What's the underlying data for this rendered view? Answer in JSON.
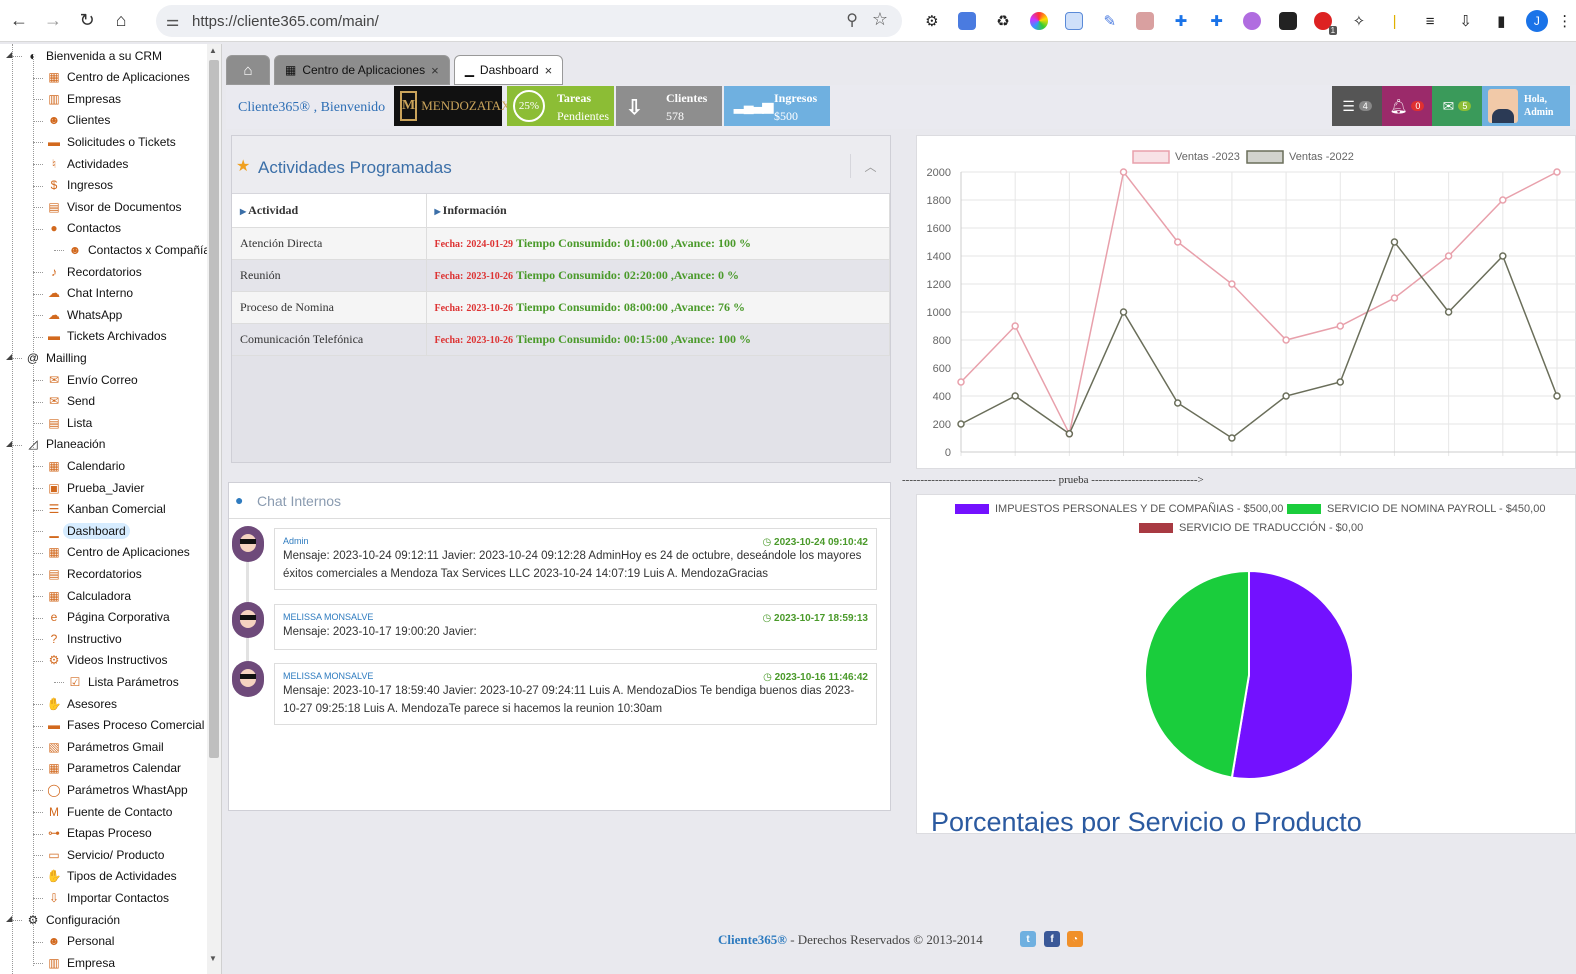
{
  "browser": {
    "url": "https://cliente365.com/main/",
    "profile_initial": "J",
    "ext_badge": "1"
  },
  "sidebar": {
    "items": [
      {
        "label": "Bienvenida a su CRM",
        "icon": "shield-icon",
        "glyph": "◐",
        "level": 0
      },
      {
        "label": "Centro de Aplicaciones",
        "icon": "apps-icon",
        "glyph": "▦",
        "level": 1
      },
      {
        "label": "Empresas",
        "icon": "building-icon",
        "glyph": "▥",
        "level": 1
      },
      {
        "label": "Clientes",
        "icon": "users-icon",
        "glyph": "☻",
        "level": 1
      },
      {
        "label": "Solicitudes o Tickets",
        "icon": "ticket-icon",
        "glyph": "▬",
        "level": 1
      },
      {
        "label": "Actividades",
        "icon": "activity-icon",
        "glyph": "♮",
        "level": 1
      },
      {
        "label": "Ingresos",
        "icon": "dollar-icon",
        "glyph": "$",
        "level": 1
      },
      {
        "label": "Visor de Documentos",
        "icon": "document-icon",
        "glyph": "▤",
        "level": 1
      },
      {
        "label": "Contactos",
        "icon": "contact-icon",
        "glyph": "●",
        "level": 1
      },
      {
        "label": "Contactos x Compañía",
        "icon": "contacts-company-icon",
        "glyph": "☻",
        "level": 2
      },
      {
        "label": "Recordatorios",
        "icon": "bell-icon",
        "glyph": "♪",
        "level": 1
      },
      {
        "label": "Chat Interno",
        "icon": "chat-icon",
        "glyph": "☁",
        "level": 1
      },
      {
        "label": "WhatsApp",
        "icon": "whatsapp-icon",
        "glyph": "☁",
        "level": 1
      },
      {
        "label": "Tickets Archivados",
        "icon": "archive-icon",
        "glyph": "▬",
        "level": 1
      },
      {
        "label": "Mailling",
        "icon": "at-icon",
        "glyph": "@",
        "level": 0
      },
      {
        "label": "Envío Correo",
        "icon": "envelope-icon",
        "glyph": "✉",
        "level": 1
      },
      {
        "label": "Send",
        "icon": "send-icon",
        "glyph": "✉",
        "level": 1
      },
      {
        "label": "Lista",
        "icon": "list-icon",
        "glyph": "▤",
        "level": 1
      },
      {
        "label": "Planeación",
        "icon": "chart-area-icon",
        "glyph": "◿",
        "level": 0
      },
      {
        "label": "Calendario",
        "icon": "calendar-icon",
        "glyph": "▦",
        "level": 1
      },
      {
        "label": "Prueba_Javier",
        "icon": "calendar-check-icon",
        "glyph": "▣",
        "level": 1
      },
      {
        "label": "Kanban Comercial",
        "icon": "kanban-icon",
        "glyph": "☰",
        "level": 1
      },
      {
        "label": "Dashboard",
        "icon": "dashboard-chart-icon",
        "glyph": "▁",
        "level": 1,
        "active": true
      },
      {
        "label": "Centro de Aplicaciones",
        "icon": "apps-icon",
        "glyph": "▦",
        "level": 1
      },
      {
        "label": "Recordatorios",
        "icon": "notes-icon",
        "glyph": "▤",
        "level": 1
      },
      {
        "label": "Calculadora",
        "icon": "calculator-icon",
        "glyph": "▦",
        "level": 1
      },
      {
        "label": "Página Corporativa",
        "icon": "edge-icon",
        "glyph": "e",
        "level": 1
      },
      {
        "label": "Instructivo",
        "icon": "question-icon",
        "glyph": "?",
        "level": 1
      },
      {
        "label": "Videos Instructivos",
        "icon": "gear-icon",
        "glyph": "⚙",
        "level": 1
      },
      {
        "label": "Lista Parámetros",
        "icon": "checkbox-icon",
        "glyph": "☑",
        "level": 2
      },
      {
        "label": "Asesores",
        "icon": "handshake-icon",
        "glyph": "✋",
        "level": 1
      },
      {
        "label": "Fases Proceso Comercial",
        "icon": "truck-icon",
        "glyph": "▬",
        "level": 1
      },
      {
        "label": "Parámetros Gmail",
        "icon": "gmail-icon",
        "glyph": "▧",
        "level": 1
      },
      {
        "label": "Parametros Calendar",
        "icon": "calendar-icon",
        "glyph": "▦",
        "level": 1
      },
      {
        "label": "Parámetros WhastApp",
        "icon": "whatsapp-icon",
        "glyph": "◯",
        "level": 1
      },
      {
        "label": "Fuente de Contacto",
        "icon": "source-icon",
        "glyph": "M",
        "level": 1
      },
      {
        "label": "Etapas Proceso",
        "icon": "flow-icon",
        "glyph": "⊶",
        "level": 1
      },
      {
        "label": "Servicio/ Producto",
        "icon": "briefcase-icon",
        "glyph": "▭",
        "level": 1
      },
      {
        "label": "Tipos de Actividades",
        "icon": "hand-icon",
        "glyph": "✋",
        "level": 1
      },
      {
        "label": "Importar Contactos",
        "icon": "download-icon",
        "glyph": "⇩",
        "level": 1
      },
      {
        "label": "Configuración",
        "icon": "gears-icon",
        "glyph": "⚙",
        "level": 0
      },
      {
        "label": "Personal",
        "icon": "users-icon",
        "glyph": "☻",
        "level": 1
      },
      {
        "label": "Empresa",
        "icon": "building-icon",
        "glyph": "▥",
        "level": 1
      }
    ]
  },
  "tabs": [
    {
      "label": "Centro de Aplicaciones"
    },
    {
      "label": "Dashboard"
    }
  ],
  "header": {
    "welcome": "Cliente365® , Bienvenido",
    "logo_text": "MENDOZATAX",
    "tareas_pct": "25%",
    "tareas_title": "Tareas",
    "tareas_sub": "Pendientes",
    "clientes_title": "Clientes",
    "clientes_value": "578",
    "ingresos_title": "Ingresos",
    "ingresos_value": "$500",
    "tasks_badge": "4",
    "alerts_badge": "0",
    "mail_badge": "5",
    "user_greeting": "Hola,",
    "user_name": "Admin",
    "colors": {
      "tareas": "#8cbd35",
      "clientes": "#8e8e8e",
      "ingresos": "#6fb0e0",
      "tasks": "#555555",
      "alerts": "#9b2a6a",
      "mail": "#3a9a5a"
    }
  },
  "activities": {
    "title": "Actividades Programadas",
    "col_activity": "Actividad",
    "col_info": "Información",
    "fecha_label": "Fecha:",
    "rows": [
      {
        "activity": "Atención Directa",
        "date": "2024-01-29",
        "info": "Tiempo Consumido: 01:00:00 ,Avance: 100 %"
      },
      {
        "activity": "Reunión",
        "date": "2023-10-26",
        "info": "Tiempo Consumido: 02:20:00 ,Avance: 0 %"
      },
      {
        "activity": "Proceso de Nomina",
        "date": "2023-10-26",
        "info": "Tiempo Consumido: 08:00:00 ,Avance: 76 %"
      },
      {
        "activity": "Comunicación Telefónica",
        "date": "2023-10-26",
        "info": "Tiempo Consumido: 00:15:00 ,Avance: 100 %"
      }
    ]
  },
  "chat": {
    "title": "Chat Internos",
    "messages": [
      {
        "author": "Admin",
        "time": "2023-10-24 09:10:42",
        "text": "Mensaje: 2023-10-24 09:12:11 Javier: 2023-10-24 09:12:28 AdminHoy es 24 de octubre, deseándole los mayores éxitos comerciales a Mendoza Tax Services LLC 2023-10-24 14:07:19 Luis A. MendozaGracias"
      },
      {
        "author": "MELISSA MONSALVE",
        "time": "2023-10-17 18:59:13",
        "text": "Mensaje: 2023-10-17 19:00:20 Javier:"
      },
      {
        "author": "MELISSA MONSALVE",
        "time": "2023-10-16 11:46:42",
        "text": "Mensaje: 2023-10-17 18:59:40 Javier: 2023-10-27 09:24:11 Luis A. MendozaDios Te bendiga buenos dias 2023-10-27 09:25:18 Luis A. MendozaTe parece si hacemos la reunion 10:30am"
      }
    ]
  },
  "divider_text": "------------------------------------------ prueba ----------------------------->",
  "chart_data": [
    {
      "type": "line",
      "ylim": [
        0,
        2000
      ],
      "yticks": [
        0,
        200,
        400,
        600,
        800,
        1000,
        1200,
        1400,
        1600,
        1800,
        2000
      ],
      "x": [
        1,
        2,
        3,
        4,
        5,
        6,
        7,
        8,
        9,
        10,
        11,
        12
      ],
      "legend_position": "top",
      "grid": true,
      "series": [
        {
          "name": "Ventas -2023",
          "color": "#e8a0ab",
          "values": [
            500,
            900,
            130,
            2000,
            1500,
            1200,
            800,
            900,
            1100,
            1400,
            1800,
            2000
          ]
        },
        {
          "name": "Ventas -2022",
          "color": "#6a6e5a",
          "values": [
            200,
            400,
            130,
            1000,
            350,
            100,
            400,
            500,
            1500,
            1000,
            1400,
            400
          ]
        }
      ]
    },
    {
      "type": "pie",
      "title": "Porcentajes por Servicio o Producto",
      "legend_position": "top",
      "slices": [
        {
          "label": "IMPUESTOS PERSONALES Y DE COMPAÑIAS - $500,00",
          "value": 500,
          "color": "#7311ff"
        },
        {
          "label": "SERVICIO DE NOMINA PAYROLL - $450,00",
          "value": 450,
          "color": "#1acd3c"
        },
        {
          "label": "SERVICIO DE TRADUCCIÓN - $0,00",
          "value": 0,
          "color": "#a83a42"
        }
      ]
    }
  ],
  "footer": {
    "brand": "Cliente365®",
    "text": " - Derechos Reservados © 2013-2014"
  }
}
